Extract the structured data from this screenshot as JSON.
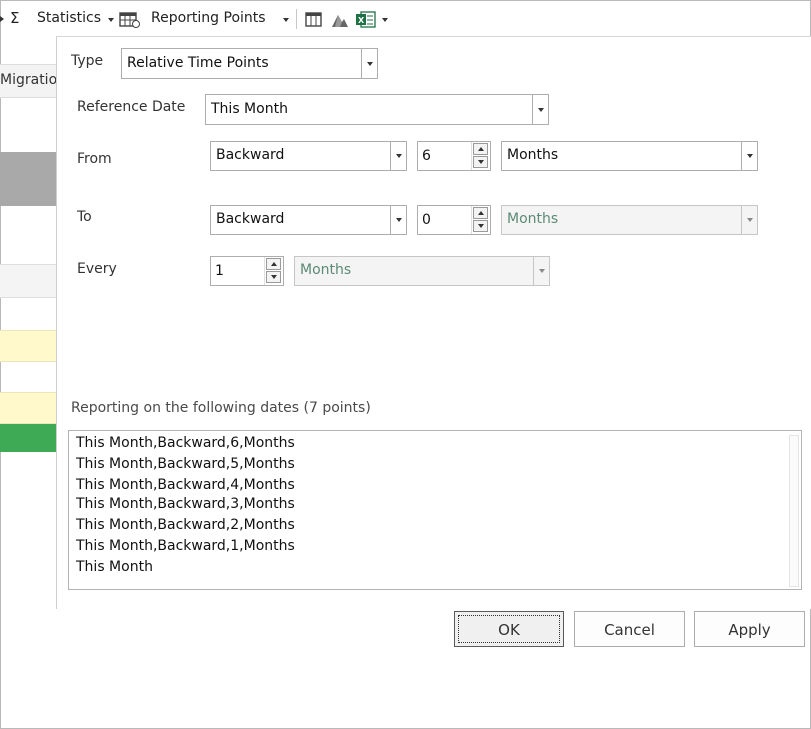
{
  "toolbar": {
    "sigma": "Σ",
    "statistics_label": "Statistics",
    "reporting_points_label": "Reporting Points"
  },
  "background": {
    "column_header": "Migratio"
  },
  "dialog": {
    "type_label": "Type",
    "type_value": "Relative Time Points",
    "reference_date_label": "Reference Date",
    "reference_date_value": "This Month",
    "from_label": "From",
    "from_direction": "Backward",
    "from_amount": "6",
    "from_unit": "Months",
    "to_label": "To",
    "to_direction": "Backward",
    "to_amount": "0",
    "to_unit": "Months",
    "every_label": "Every",
    "every_amount": "1",
    "every_unit": "Months",
    "points_heading": "Reporting on the following dates (7 points)",
    "points": [
      "This Month,Backward,6,Months",
      "This Month,Backward,5,Months",
      "This Month,Backward,4,Months",
      "This Month,Backward,3,Months",
      "This Month,Backward,2,Months",
      "This Month,Backward,1,Months",
      "This Month"
    ],
    "ok_label": "OK",
    "cancel_label": "Cancel",
    "apply_label": "Apply"
  },
  "colors": {
    "row_highlight": "#fff9cc",
    "row_green": "#3faa55",
    "row_gray": "#a8a8a8"
  }
}
